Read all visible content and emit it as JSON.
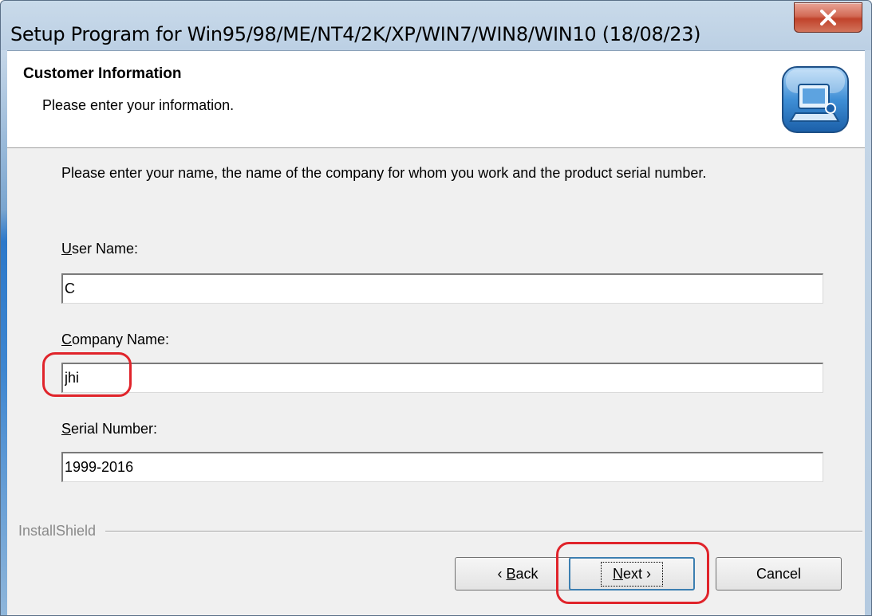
{
  "window": {
    "title": "Setup Program for Win95/98/ME/NT4/2K/XP/WIN7/WIN8/WIN10  (18/08/23)"
  },
  "header": {
    "title": "Customer Information",
    "subtitle": "Please enter your information.",
    "icon": "setup-computer-icon"
  },
  "instructions": "Please enter your name, the name of the company for whom you work and the product serial number.",
  "fields": {
    "user_name": {
      "label_accel": "U",
      "label_rest": "ser Name:",
      "value": "C"
    },
    "company_name": {
      "label_accel": "C",
      "label_rest": "ompany Name:",
      "value": "jhi"
    },
    "serial_number": {
      "label_accel": "S",
      "label_rest": "erial Number:",
      "value": "1999-2016"
    }
  },
  "brand": "InstallShield",
  "buttons": {
    "back": {
      "arrow": "‹ ",
      "accel": "B",
      "rest": "ack"
    },
    "next": {
      "accel": "N",
      "rest": "ext",
      "arrow": " ›"
    },
    "cancel": "Cancel"
  },
  "colors": {
    "highlight": "#e0242b",
    "close_button": "#c1432b"
  }
}
